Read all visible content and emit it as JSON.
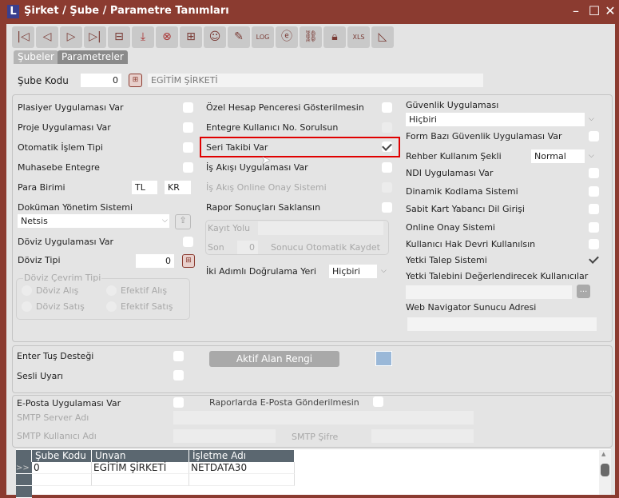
{
  "window": {
    "title": "Şirket / Şube / Parametre Tanımları",
    "logo": "L",
    "controls": [
      "minimize",
      "maximize",
      "close"
    ]
  },
  "toolbar": [
    "first-icon",
    "previous-icon",
    "next-icon",
    "last-icon",
    "folder-minus-icon",
    "download-icon",
    "cancel-icon",
    "folder-plus-icon",
    "user-icon",
    "edit-pencil-icon",
    "log-icon",
    "document-e-icon",
    "link-icon",
    "lock-icon",
    "xls-icon",
    "chart-icon"
  ],
  "tabs": [
    {
      "label": "Şubeler",
      "active": false
    },
    {
      "label": "Parametreler",
      "active": true
    }
  ],
  "sube": {
    "label": "Şube Kodu",
    "value": "0",
    "name": "EGİTİM ŞİRKETİ"
  },
  "left": {
    "plasiyer": "Plasiyer Uygulaması Var",
    "proje": "Proje Uygulaması Var",
    "otomatik": "Otomatik İşlem Tipi",
    "muhasebe": "Muhasebe Entegre",
    "para_birimi": "Para Birimi",
    "para_1": "TL",
    "para_2": "KR",
    "dokuman": "Doküman Yönetim Sistemi",
    "dokuman_value": "Netsis",
    "doviz_uyg": "Döviz Uygulaması Var",
    "doviz_tipi": "Döviz Tipi",
    "doviz_tipi_value": "0",
    "cevrim": {
      "title": "Döviz Çevrim Tipi",
      "options": [
        "Döviz Alış",
        "Efektif Alış",
        "Döviz Satış",
        "Efektif Satış"
      ]
    }
  },
  "middle": {
    "ozel": "Özel Hesap Penceresi Gösterilmesin",
    "entegre": "Entegre Kullanıcı No. Sorulsun",
    "seri": "Seri Takibi Var",
    "seri_checked": true,
    "is_akisi": "İş Akışı Uygulaması Var",
    "is_akis_online": "İş Akış Online Onay Sistemi",
    "rapor": "Rapor Sonuçları Saklansın",
    "kayit_yolu": "Kayıt Yolu",
    "son": "Son",
    "son_value": "0",
    "sonucu": "Sonucu Otomatik Kaydet",
    "iki_adim": "İki Adımlı Doğrulama Yeri",
    "iki_adim_value": "Hiçbiri"
  },
  "right": {
    "guvenlik": "Güvenlik Uygulaması",
    "guvenlik_value": "Hiçbiri",
    "form_bazi": "Form Bazı Güvenlik Uygulaması Var",
    "rehber": "Rehber Kullanım Şekli",
    "rehber_value": "Normal",
    "ndi": "NDI Uygulaması Var",
    "dinamik": "Dinamik Kodlama Sistemi",
    "sabit": "Sabit Kart Yabancı Dil Girişi",
    "online": "Online Onay Sistemi",
    "kullanici_hak": "Kullanıcı Hak Devri Kullanılsın",
    "yetki_talep": "Yetki Talep Sistemi",
    "yetki_talep_checked": true,
    "yetki_deg": "Yetki Talebini Değerlendirecek Kullanıcılar",
    "browse": "...",
    "web_nav": "Web Navigator Sunucu Adresi"
  },
  "misc": {
    "enter": "Enter Tuş Desteği",
    "sesli": "Sesli Uyarı",
    "aktif_alan": "Aktif Alan Rengi",
    "aktif_color": "#9ab8d8"
  },
  "email": {
    "eposta": "E-Posta Uygulaması Var",
    "raporlarda": "Raporlarda E-Posta Gönderilmesin",
    "smtp_server": "SMTP Server Adı",
    "smtp_user": "SMTP Kullanıcı Adı",
    "smtp_pass": "SMTP Şifre"
  },
  "grid": {
    "columns": [
      "Şube Kodu",
      "Unvan",
      "İşletme Adı"
    ],
    "rows": [
      {
        "indicator": ">>",
        "cells": [
          "0",
          "EGİTİM ŞİRKETİ",
          "NETDATA30"
        ]
      }
    ]
  },
  "colors": {
    "window_frame": "#8b3b30",
    "highlight": "#e00000"
  }
}
